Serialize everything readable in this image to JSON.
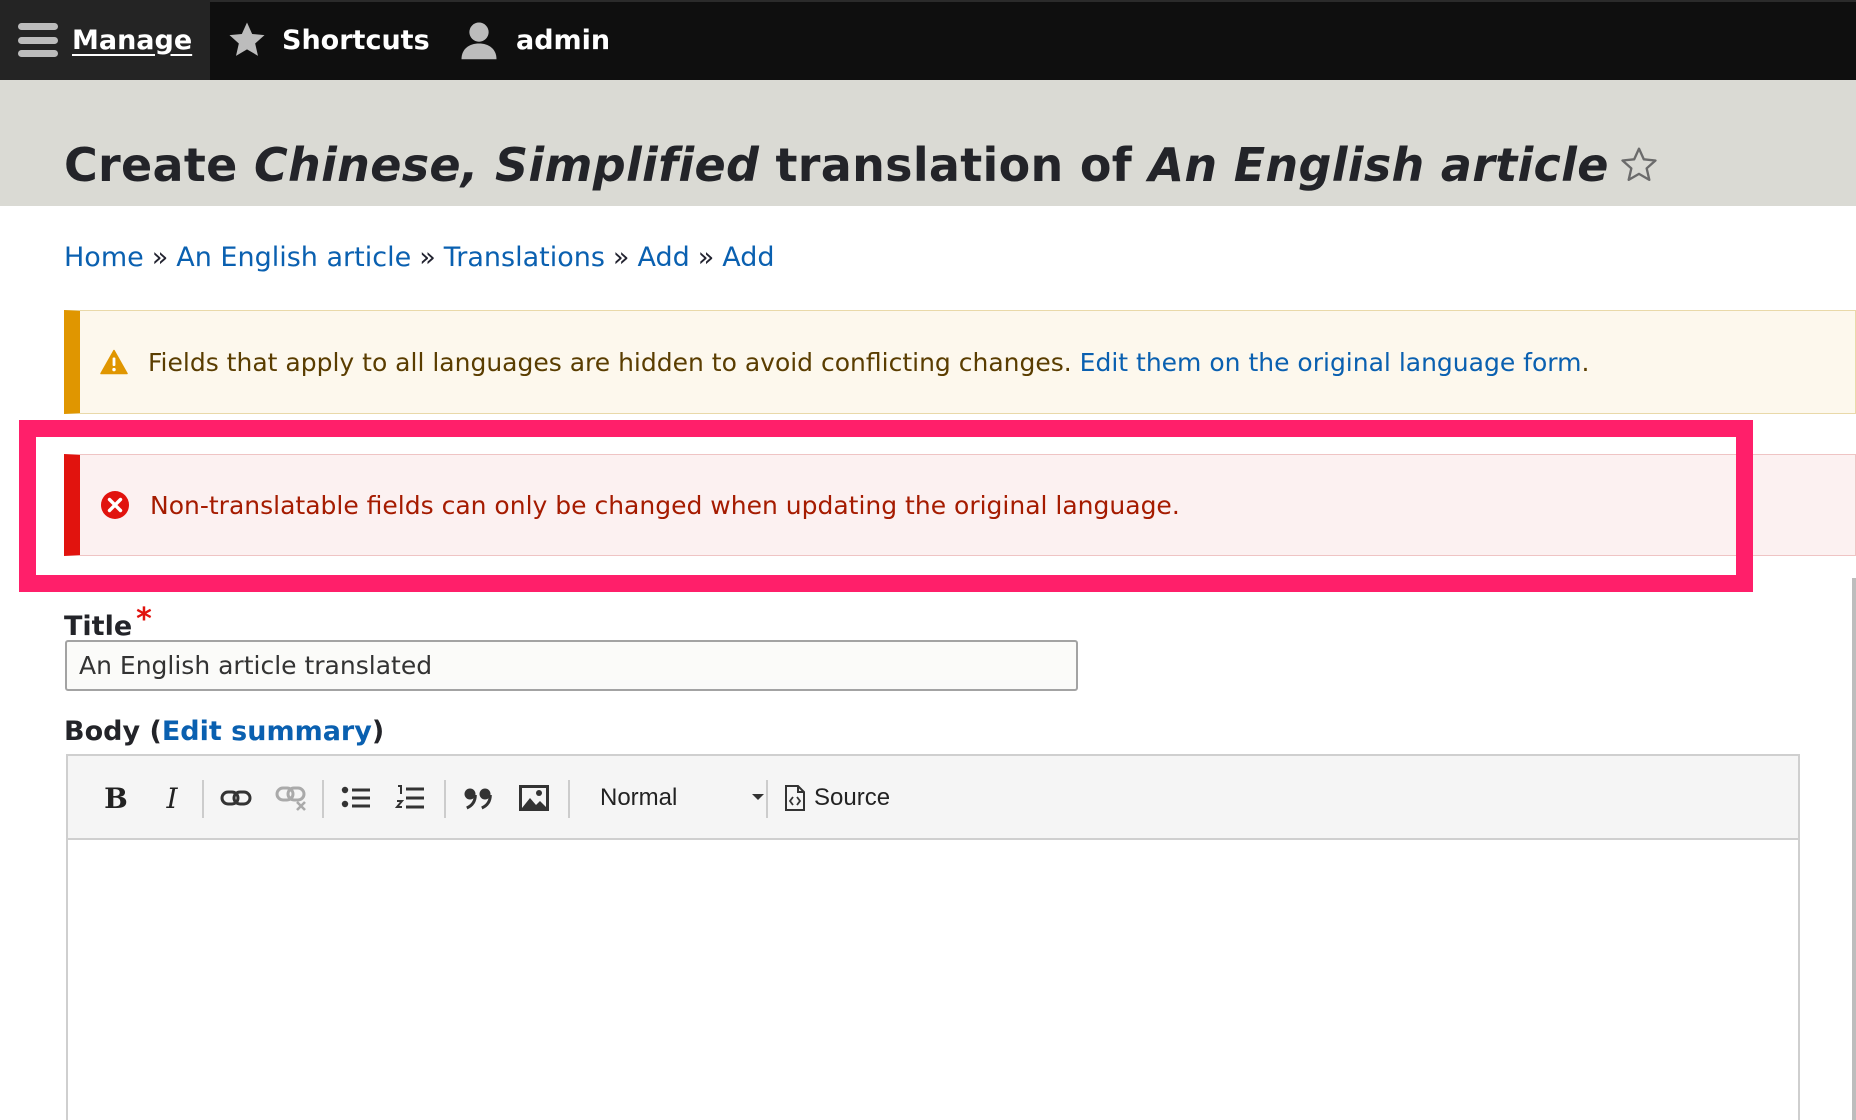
{
  "toolbar": {
    "manage": "Manage",
    "shortcuts": "Shortcuts",
    "user": "admin"
  },
  "header": {
    "title_prefix": "Create",
    "title_language": "Chinese, Simplified",
    "title_mid": "translation of",
    "title_node": "An English article"
  },
  "breadcrumb": {
    "separator": "»",
    "items": [
      "Home",
      "An English article",
      "Translations",
      "Add",
      "Add"
    ]
  },
  "messages": {
    "warning_text": "Fields that apply to all languages are hidden to avoid conflicting changes.",
    "warning_link": "Edit them on the original language form",
    "warning_end": ".",
    "error_text": "Non-translatable fields can only be changed when updating the original language."
  },
  "form": {
    "title_label": "Title",
    "required_mark": "*",
    "title_value": "An English article translated",
    "body_label": "Body",
    "body_paren_open": "(",
    "body_edit_summary": "Edit summary",
    "body_paren_close": ")"
  },
  "editor": {
    "bold_glyph": "B",
    "italic_glyph": "I",
    "format_value": "Normal",
    "source_label": "Source"
  },
  "colors": {
    "link": "#0a60b0",
    "warning_accent": "#e09600",
    "error_accent": "#e1130e",
    "highlight": "#ff1f6a"
  },
  "icons": [
    "menu-icon",
    "star-icon",
    "user-icon",
    "warning-icon",
    "error-icon",
    "bold-icon",
    "italic-icon",
    "link-icon",
    "unlink-icon",
    "bulleted-list-icon",
    "numbered-list-icon",
    "blockquote-icon",
    "image-icon",
    "source-icon"
  ]
}
